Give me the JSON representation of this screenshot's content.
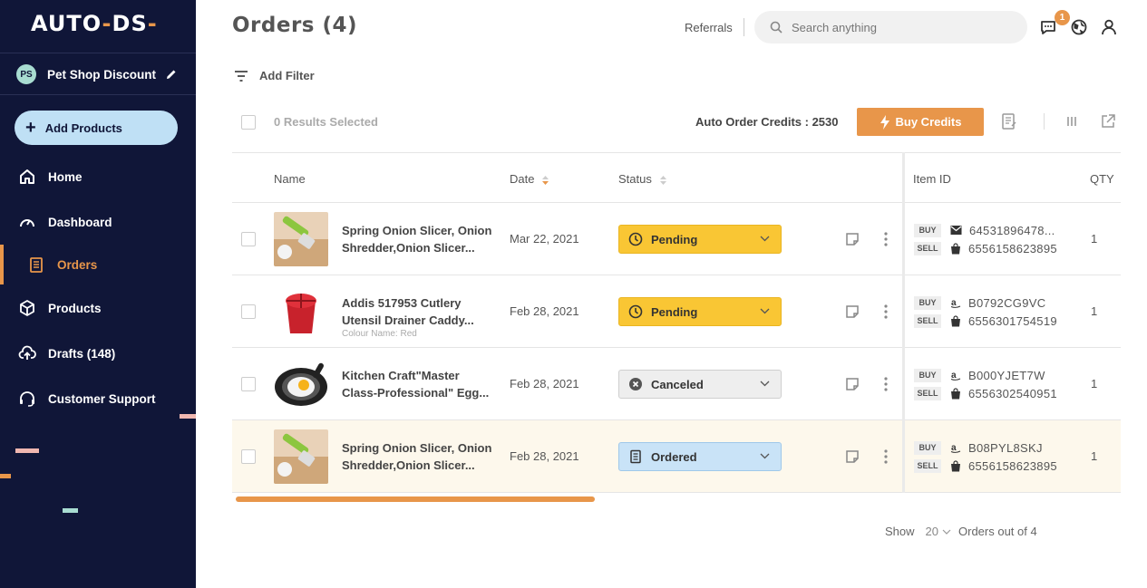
{
  "sidebar": {
    "logo_left": "AUTO",
    "logo_mid": "DS",
    "store": {
      "initials": "PS",
      "name": "Pet Shop Discount"
    },
    "add_products_label": "Add Products",
    "nav": {
      "home": "Home",
      "dashboard": "Dashboard",
      "orders": "Orders",
      "products": "Products",
      "drafts": "Drafts (148)",
      "support": "Customer Support"
    }
  },
  "header": {
    "title": "Orders (4)",
    "referrals": "Referrals",
    "search_placeholder": "Search anything",
    "notification_count": "1"
  },
  "toolbar": {
    "add_filter": "Add Filter",
    "results_selected": "0 Results Selected",
    "credits": "Auto Order Credits : 2530",
    "buy_credits": "Buy Credits"
  },
  "table": {
    "columns": {
      "name": "Name",
      "date": "Date",
      "status": "Status",
      "item_id": "Item ID",
      "qty": "QTY"
    },
    "rows": [
      {
        "name_line1": "Spring Onion Slicer, Onion",
        "name_line2": "Shredder,Onion Slicer...",
        "variant": "",
        "date": "Mar 22, 2021",
        "status": "Pending",
        "buy_tag": "BUY",
        "buy_id": "64531896478...",
        "sell_tag": "SELL",
        "sell_id": "6556158623895",
        "qty": "1"
      },
      {
        "name_line1": "Addis 517953 Cutlery",
        "name_line2": "Utensil Drainer Caddy...",
        "variant": "Colour Name: Red",
        "date": "Feb 28, 2021",
        "status": "Pending",
        "buy_tag": "BUY",
        "buy_id": "B0792CG9VC",
        "sell_tag": "SELL",
        "sell_id": "6556301754519",
        "qty": "1"
      },
      {
        "name_line1": "Kitchen Craft\"Master",
        "name_line2": "Class-Professional\" Egg...",
        "variant": "",
        "date": "Feb 28, 2021",
        "status": "Canceled",
        "buy_tag": "BUY",
        "buy_id": "B000YJET7W",
        "sell_tag": "SELL",
        "sell_id": "6556302540951",
        "qty": "1"
      },
      {
        "name_line1": "Spring Onion Slicer, Onion",
        "name_line2": "Shredder,Onion Slicer...",
        "variant": "",
        "date": "Feb 28, 2021",
        "status": "Ordered",
        "buy_tag": "BUY",
        "buy_id": "B08PYL8SKJ",
        "sell_tag": "SELL",
        "sell_id": "6556158623895",
        "qty": "1"
      }
    ]
  },
  "pager": {
    "show": "Show",
    "page_size": "20",
    "out_of": "Orders out of 4"
  },
  "colors": {
    "sidebar_bg": "#101638",
    "accent": "#e8964a",
    "pending": "#f9c634",
    "ordered": "#c9e3f7",
    "canceled": "#eeeeee",
    "highlight_row": "#fdf8ec"
  }
}
